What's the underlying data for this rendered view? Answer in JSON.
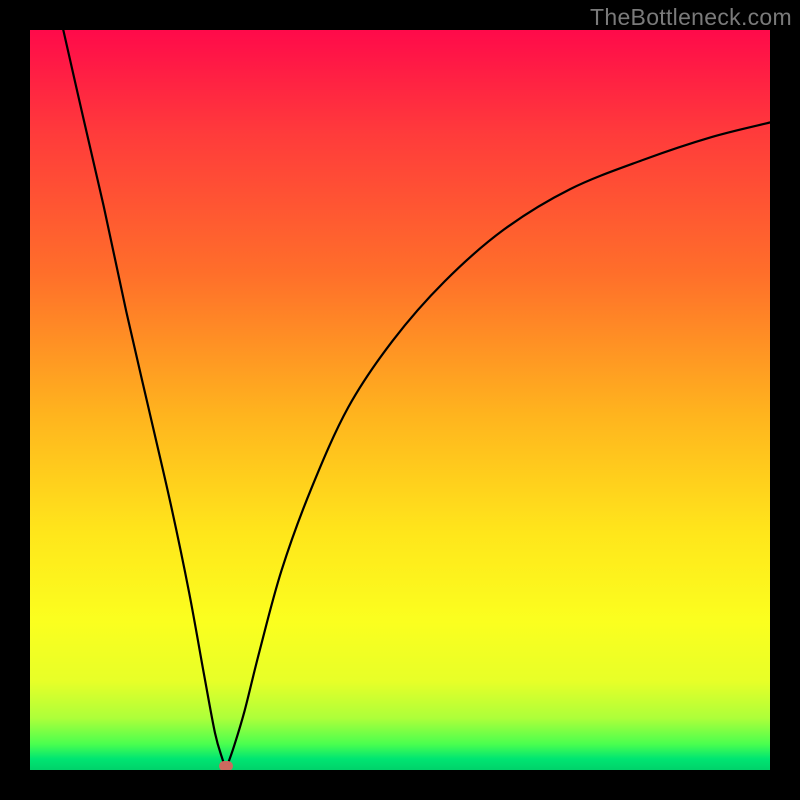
{
  "watermark": "TheBottleneck.com",
  "chart_data": {
    "type": "line",
    "title": "",
    "xlabel": "",
    "ylabel": "",
    "xlim": [
      0,
      100
    ],
    "ylim": [
      0,
      100
    ],
    "grid": false,
    "legend": false,
    "background": "red-yellow-green vertical gradient (green = best, at bottom)",
    "series": [
      {
        "name": "left-branch",
        "x": [
          4.5,
          7,
          10,
          13,
          16,
          19,
          21.5,
          23.5,
          25,
          26,
          26.5
        ],
        "values": [
          100,
          89,
          76,
          62,
          49,
          36,
          24,
          13,
          5,
          1.5,
          0.2
        ]
      },
      {
        "name": "right-branch",
        "x": [
          26.5,
          27.5,
          29,
          31,
          34,
          38,
          43,
          49,
          56,
          64,
          73,
          83,
          92,
          100
        ],
        "values": [
          0.2,
          3,
          8,
          16,
          27,
          38,
          49,
          58,
          66,
          73,
          78.5,
          82.5,
          85.5,
          87.5
        ]
      }
    ],
    "annotations": [
      {
        "name": "minimum-marker",
        "x": 26.5,
        "y": 0.5,
        "shape": "rounded-dot",
        "color": "#cc6a5f"
      }
    ]
  }
}
